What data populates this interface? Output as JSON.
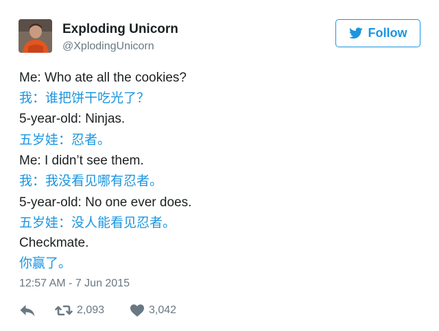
{
  "author": {
    "display_name": "Exploding Unicorn",
    "handle": "@XplodingUnicorn",
    "avatar_icon": "user-avatar"
  },
  "follow_button": {
    "label": "Follow",
    "icon": "twitter-bird-icon",
    "color": "#1b95e0"
  },
  "tweet": {
    "lines": [
      {
        "text": "Me: Who ate all the cookies?",
        "lang": "en"
      },
      {
        "text": "我：谁把饼干吃光了？",
        "lang": "zh"
      },
      {
        "text": "5-year-old: Ninjas.",
        "lang": "en"
      },
      {
        "text": "五岁娃：忍者。",
        "lang": "zh"
      },
      {
        "text": "Me: I didn’t see them.",
        "lang": "en"
      },
      {
        "text": "我：我没看见哪有忍者。",
        "lang": "zh"
      },
      {
        "text": "5-year-old: No one ever does.",
        "lang": "en"
      },
      {
        "text": "五岁娃：没人能看见忍者。",
        "lang": "zh"
      },
      {
        "text": "Checkmate.",
        "lang": "en"
      },
      {
        "text": "你赢了。",
        "lang": "zh"
      }
    ],
    "timestamp": "12:57 AM - 7 Jun 2015"
  },
  "actions": {
    "reply_icon": "reply-icon",
    "retweet_icon": "retweet-icon",
    "retweet_count": "2,093",
    "like_icon": "heart-icon",
    "like_count": "3,042"
  },
  "colors": {
    "link_blue": "#1b95e0",
    "text": "#1c2022",
    "muted": "#697882"
  }
}
